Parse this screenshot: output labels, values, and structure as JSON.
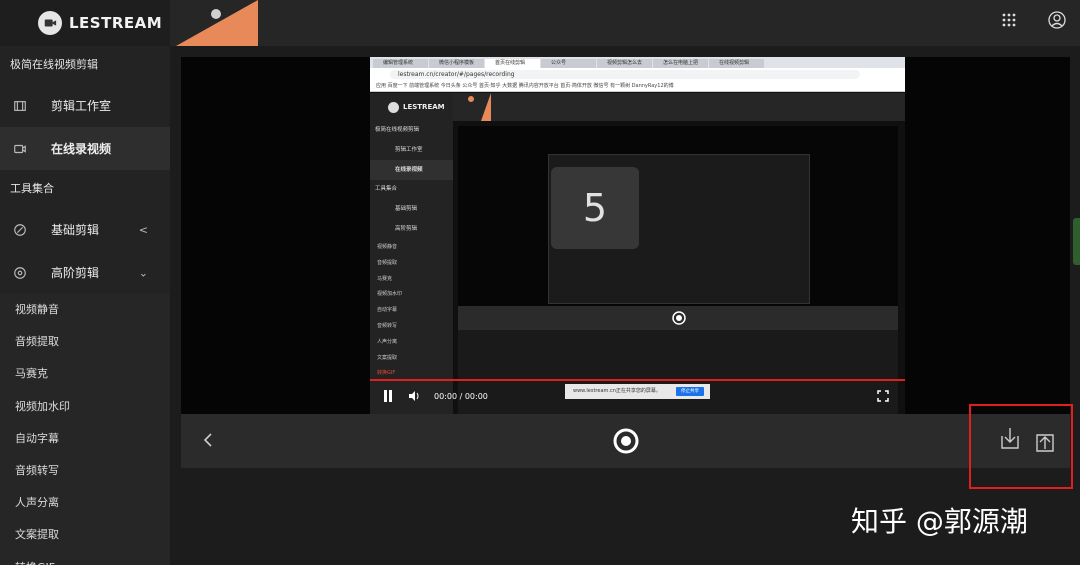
{
  "app": {
    "brand": "LESTREAM"
  },
  "sidebar": {
    "section1": "极简在线视频剪辑",
    "items": [
      {
        "label": "剪辑工作室",
        "icon": "film-icon"
      },
      {
        "label": "在线录视频",
        "icon": "camera-icon"
      }
    ],
    "section2": "工具集合",
    "tools": [
      {
        "label": "基础剪辑",
        "icon": "basic-edit-icon",
        "arrow": "<"
      },
      {
        "label": "高阶剪辑",
        "icon": "advanced-edit-icon",
        "arrow": "v"
      }
    ],
    "subitems": [
      "视频静音",
      "音频提取",
      "马赛克",
      "视频加水印",
      "自动字幕",
      "音频转写",
      "人声分离",
      "文案提取",
      "转换GIF"
    ]
  },
  "capture": {
    "tabs": [
      "编辑管理系统",
      "微信小程序模板",
      "首页在线剪辑",
      "公众号",
      "视频剪辑怎么去",
      "怎么在电脑上把",
      "在线视频剪辑"
    ],
    "url": "lestream.cn/creator/#/pages/recording",
    "bookmarks": "应用  百度一下  前端管理系统  今日头条  公众号  首页·知乎  大数据  腾讯内容开放平台  首页·简体开放  微信号  有一颗树  DannyRay12的博",
    "brand": "LESTREAM",
    "section1": "极简在线视频剪辑",
    "nav": [
      "剪辑工作室",
      "在线录视频"
    ],
    "section2": "工具集合",
    "tools": [
      "基础剪辑",
      "高阶剪辑"
    ],
    "subitems": [
      "视频静音",
      "音频提取",
      "马赛克",
      "视频加水印",
      "自动字幕",
      "音频转写",
      "人声分离",
      "文案提取",
      "转换GIF"
    ],
    "countdown": "5",
    "time": "00:00 / 00:00",
    "share_notice": "www.lestream.cn正在共享您的屏幕。",
    "stop_share": "停止共享"
  },
  "watermark": "知乎 @郭源潮"
}
